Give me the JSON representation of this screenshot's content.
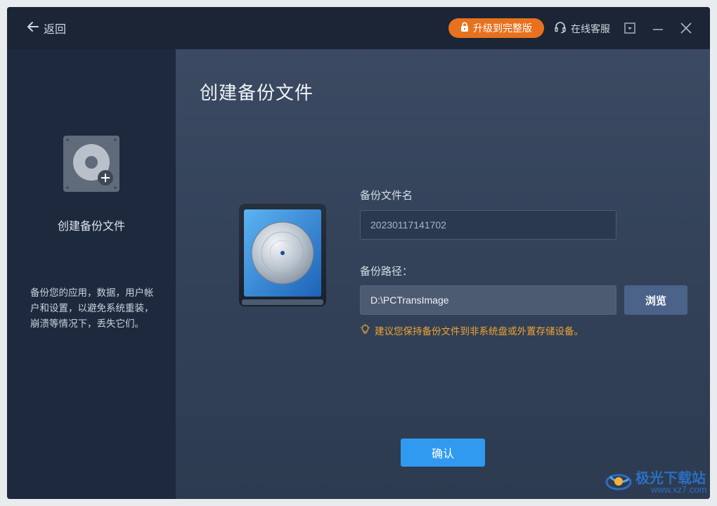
{
  "titlebar": {
    "back_label": "返回",
    "upgrade_label": "升级到完整版",
    "service_label": "在线客服"
  },
  "sidebar": {
    "title": "创建备份文件",
    "description": "备份您的应用，数据，用户帐户和设置，以避免系统重装，崩溃等情况下，丢失它们。"
  },
  "main": {
    "page_title": "创建备份文件",
    "name_label": "备份文件名",
    "name_value": "20230117141702",
    "path_label": "备份路径：",
    "path_value": "D:\\PCTransImage",
    "browse_label": "浏览",
    "tip": "建议您保持备份文件到非系统盘或外置存储设备。",
    "confirm_label": "确认"
  },
  "watermark": {
    "cn": "极光下载站",
    "en": "www.xz7.com"
  },
  "colors": {
    "accent": "#2f9af0",
    "upgrade": "#e8711f",
    "tip": "#f0a433"
  }
}
